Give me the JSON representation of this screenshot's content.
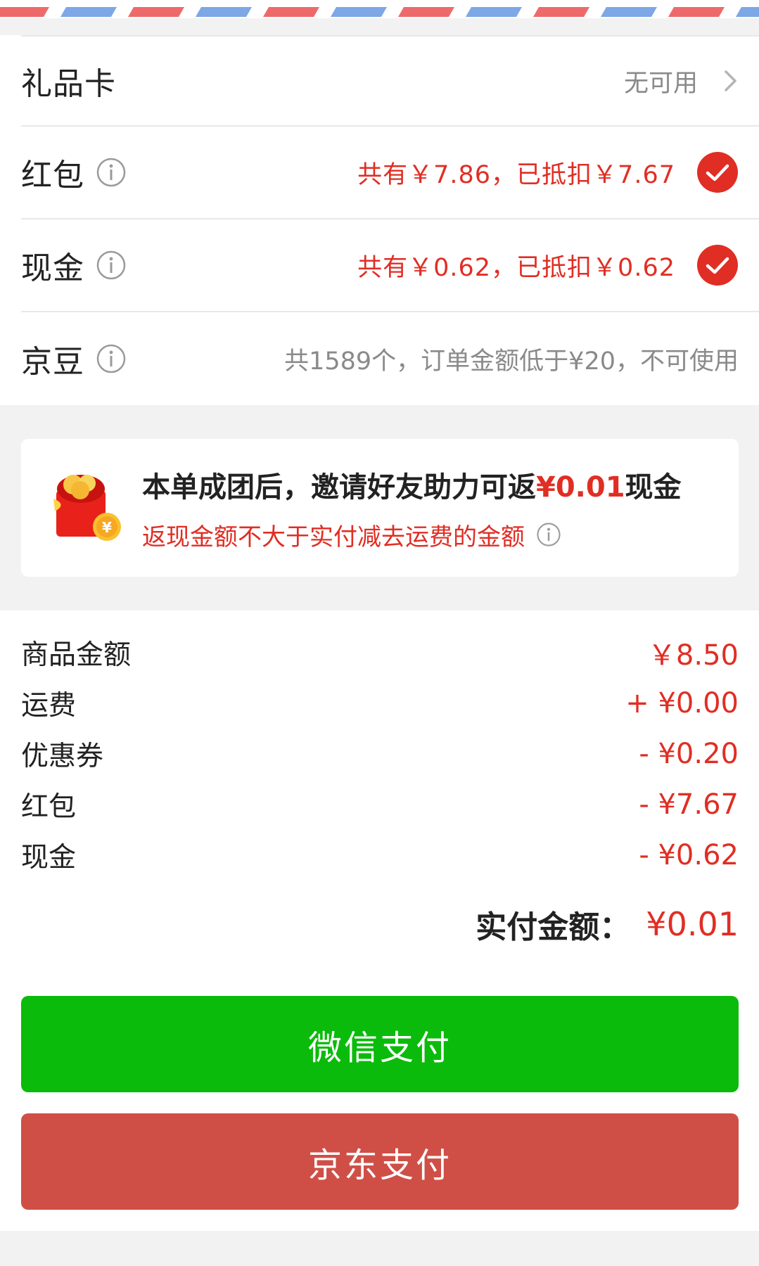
{
  "colors": {
    "accent_red": "#e02e24",
    "wechat_green": "#0bbb0b",
    "jd_red": "#cf4f47",
    "airmail_red": "#ee6a6a",
    "airmail_blue": "#7da7e5"
  },
  "options": {
    "gift_card": {
      "label": "礼品卡",
      "status": "无可用",
      "icon": "chevron-right-icon"
    },
    "red_packet": {
      "label": "红包",
      "detail": "共有￥7.86，已抵扣￥7.67",
      "checked": true
    },
    "cash": {
      "label": "现金",
      "detail": "共有￥0.62，已抵扣￥0.62",
      "checked": true
    },
    "jd_beans": {
      "label": "京豆",
      "detail": "共1589个，订单金额低于¥20，不可使用"
    }
  },
  "promo": {
    "title_prefix": "本单成团后，邀请好友助力可返",
    "amount": "¥0.01",
    "title_suffix": "现金",
    "subtitle": "返现金额不大于实付减去运费的金额"
  },
  "summary": {
    "items": [
      {
        "label": "商品金额",
        "value": "￥8.50"
      },
      {
        "label": "运费",
        "value": "+ ¥0.00"
      },
      {
        "label": "优惠券",
        "value": "- ¥0.20"
      },
      {
        "label": "红包",
        "value": "- ¥7.67"
      },
      {
        "label": "现金",
        "value": "- ¥0.62"
      }
    ],
    "total_label": "实付金额：",
    "total_value": "¥0.01"
  },
  "buttons": {
    "wechat_pay": "微信支付",
    "jd_pay": "京东支付"
  }
}
